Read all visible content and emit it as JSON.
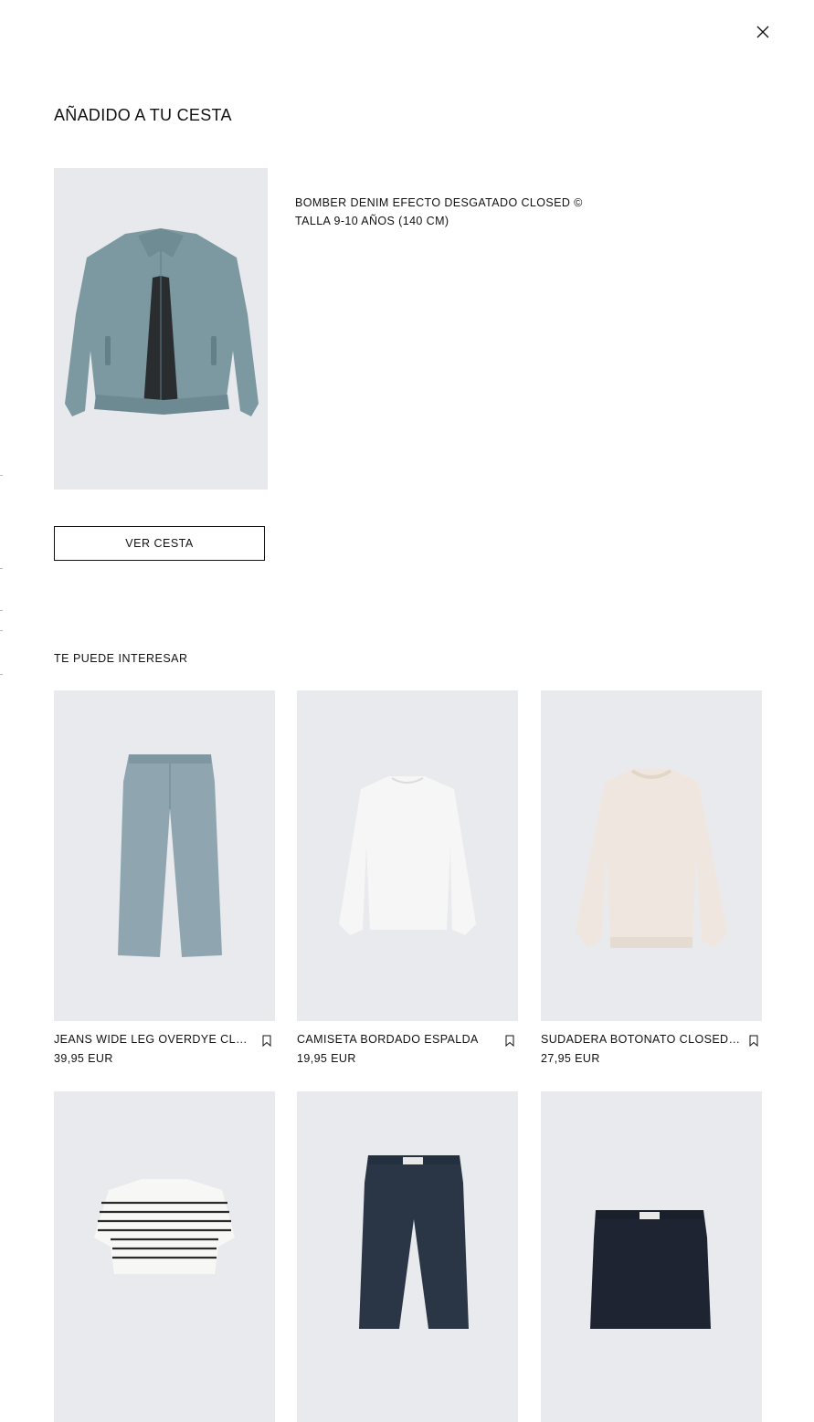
{
  "modal": {
    "title": "AÑADIDO A TU CESTA",
    "close_icon": "close-icon",
    "added_item": {
      "name": "BOMBER DENIM EFECTO DESGATADO CLOSED ©",
      "size": "TALLA 9-10 AÑOS (140 CM)"
    },
    "view_cart_label": "VER CESTA"
  },
  "recommendations": {
    "title": "TE PUEDE INTERESAR",
    "items": [
      {
        "name": "JEANS WIDE LEG OVERDYE CLOSED",
        "price": "39,95 EUR",
        "icon": "bookmark-icon"
      },
      {
        "name": "CAMISETA BORDADO ESPALDA",
        "price": "19,95 EUR",
        "icon": "bookmark-icon"
      },
      {
        "name": "SUDADERA BOTONATO CLOSED ©",
        "price": "27,95 EUR",
        "icon": "bookmark-icon"
      },
      {
        "name": "",
        "price": ""
      },
      {
        "name": "",
        "price": ""
      },
      {
        "name": "",
        "price": ""
      }
    ]
  },
  "colors": {
    "background": "#ffffff",
    "text": "#111111",
    "image_bg": "#e9eaed",
    "denim": "#7d9aa3"
  }
}
